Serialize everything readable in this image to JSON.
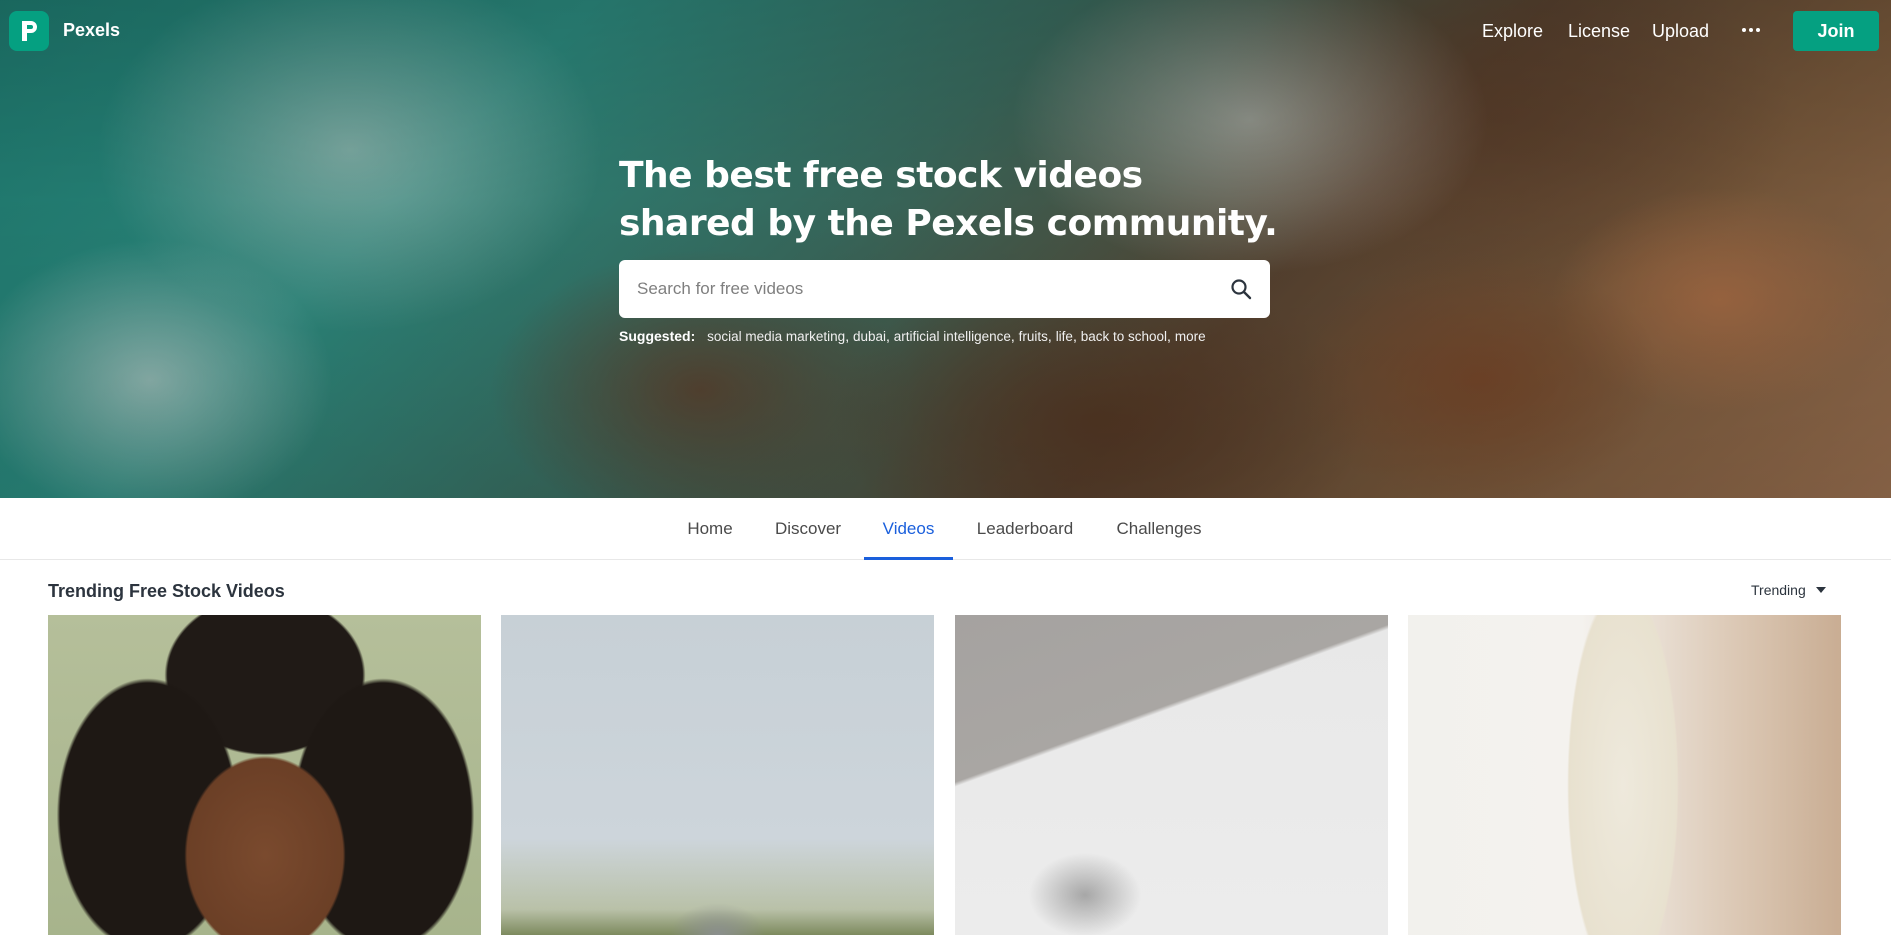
{
  "nav": {
    "brand": "Pexels",
    "links": [
      "Explore",
      "License",
      "Upload"
    ],
    "join_label": "Join"
  },
  "hero": {
    "title": "The best free stock videos shared by the Pexels community.",
    "search_placeholder": "Search for free videos",
    "suggested_label": "Suggested:",
    "suggestions": [
      "social media marketing",
      "dubai",
      "artificial intelligence",
      "fruits",
      "life",
      "back to school",
      "more"
    ]
  },
  "tabs": [
    {
      "label": "Home",
      "active": false
    },
    {
      "label": "Discover",
      "active": false
    },
    {
      "label": "Videos",
      "active": true
    },
    {
      "label": "Leaderboard",
      "active": false
    },
    {
      "label": "Challenges",
      "active": false
    }
  ],
  "section": {
    "title": "Trending Free Stock Videos",
    "sort_label": "Trending"
  },
  "colors": {
    "brand": "#05a081",
    "active_tab": "#1a5fdc"
  },
  "icons": [
    "pexels-logo-icon",
    "more-dots-icon",
    "search-icon",
    "caret-down-icon"
  ]
}
